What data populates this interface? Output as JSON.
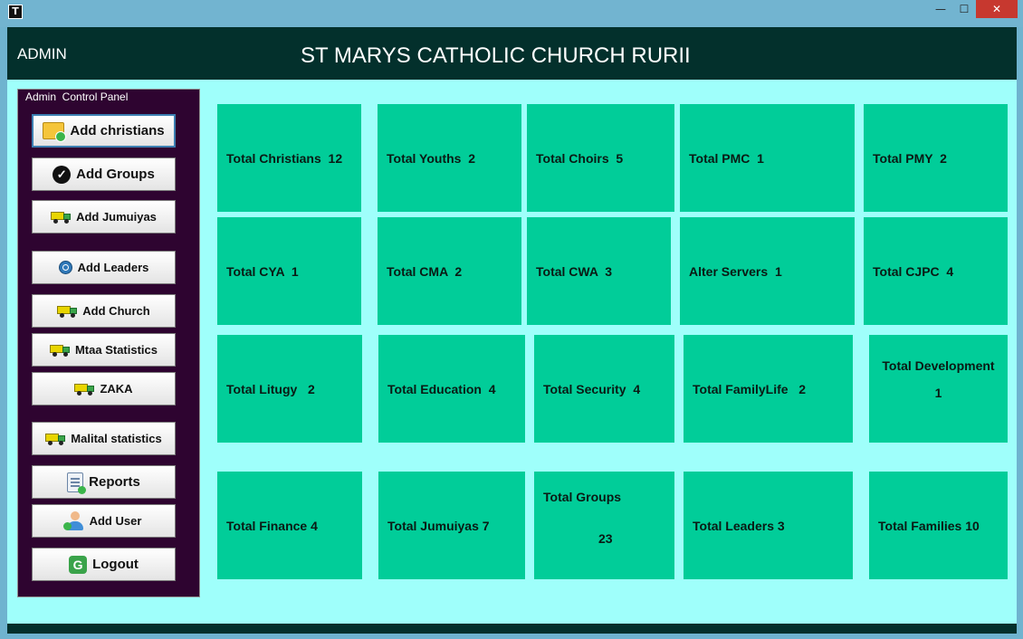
{
  "window": {
    "min_glyph": "—",
    "max_glyph": "☐",
    "close_glyph": "✕"
  },
  "header": {
    "role": "ADMIN",
    "title": "ST MARYS CATHOLIC CHURCH RURII"
  },
  "panel": {
    "legend": "Admin  Control Panel",
    "buttons": [
      {
        "label": "Add christians",
        "icon": "folder-add-icon"
      },
      {
        "label": "Add Groups",
        "icon": "check-badge-icon"
      },
      {
        "label": "Add Jumuiyas",
        "icon": "truck-icon"
      },
      {
        "label": "Add Leaders",
        "icon": "search-icon"
      },
      {
        "label": "Add Church",
        "icon": "truck-icon"
      },
      {
        "label": "Mtaa Statistics",
        "icon": "truck-icon"
      },
      {
        "label": "ZAKA",
        "icon": "truck-icon"
      },
      {
        "label": "Malital statistics",
        "icon": "truck-icon"
      },
      {
        "label": "Reports",
        "icon": "report-icon"
      },
      {
        "label": "Add User",
        "icon": "add-user-icon"
      },
      {
        "label": "Logout",
        "icon": "logout-icon"
      }
    ]
  },
  "stats": [
    {
      "text": "Total Christians  12"
    },
    {
      "text": "Total Youths  2"
    },
    {
      "text": "Total Choirs  5"
    },
    {
      "text": "Total PMC  1"
    },
    {
      "text": "Total PMY  2"
    },
    {
      "text": "Total CYA  1"
    },
    {
      "text": "Total CMA  2"
    },
    {
      "text": "Total CWA  3"
    },
    {
      "text": "Alter Servers  1"
    },
    {
      "text": "Total CJPC  4"
    },
    {
      "text": "Total Litugy   2"
    },
    {
      "text": "Total Education  4"
    },
    {
      "text": "Total Security  4"
    },
    {
      "text": "Total FamilyLife   2"
    },
    {
      "label": "Total Development",
      "value": "1"
    },
    {
      "text": "Total Finance 4"
    },
    {
      "text": "Total Jumuiyas 7"
    },
    {
      "label": "Total Groups",
      "value": "23"
    },
    {
      "text": "Total Leaders 3"
    },
    {
      "text": "Total Families 10"
    }
  ],
  "colors": {
    "tile": "#01cd99",
    "header": "#03302c",
    "panel": "#2e0430",
    "background": "#9ffffb"
  }
}
